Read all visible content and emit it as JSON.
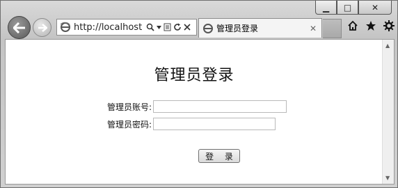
{
  "browser": {
    "url": "http://localhost",
    "tab_title": "管理员登录",
    "tab_close": "✕",
    "window_controls": {
      "minimize": "▁",
      "maximize": "□",
      "close": "✕"
    },
    "icons": [
      "home-icon",
      "star-icon",
      "gear-icon"
    ]
  },
  "page": {
    "heading": "管理员登录",
    "account_label": "管理员账号:",
    "account_value": "",
    "password_label": "管理员密码:",
    "password_value": "",
    "login_button": "登 录"
  }
}
